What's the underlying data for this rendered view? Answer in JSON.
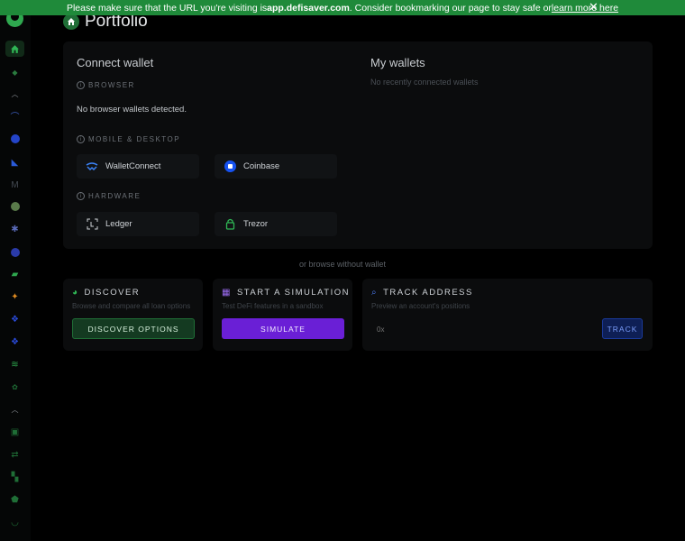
{
  "banner": {
    "text_before": "Please make sure that the URL you're visiting is ",
    "url": "app.defisaver.com",
    "text_after": ". Consider bookmarking our page to stay safe or ",
    "link": "learn more here",
    "close": "✕"
  },
  "page": {
    "title": "Portfolio"
  },
  "connect": {
    "title": "Connect wallet",
    "browser_header": "BROWSER",
    "browser_empty": "No browser wallets detected.",
    "mobile_header": "MOBILE & DESKTOP",
    "hardware_header": "HARDWARE",
    "walletconnect": "WalletConnect",
    "coinbase": "Coinbase",
    "ledger": "Ledger",
    "trezor": "Trezor"
  },
  "my_wallets": {
    "title": "My wallets",
    "empty": "No recently connected wallets"
  },
  "browse_without": "or browse without wallet",
  "discover": {
    "title": "DISCOVER",
    "subtitle": "Browse and compare all loan options",
    "button": "DISCOVER OPTIONS"
  },
  "simulation": {
    "title": "START A SIMULATION",
    "subtitle": "Test DeFi features in a sandbox",
    "button": "SIMULATE"
  },
  "track": {
    "title": "TRACK ADDRESS",
    "subtitle": "Preview an account's positions",
    "placeholder": "0x",
    "button": "TRACK"
  },
  "colors": {
    "banner": "#1f8a3a",
    "simulate": "#6a1fd6",
    "track": "#0e1f55",
    "discover": "#143a21"
  },
  "sidebar_icons": [
    "home-icon",
    "wallet-icon",
    "collapse-icon",
    "protocol-icon",
    "protocol-icon",
    "protocol-icon",
    "protocol-icon",
    "protocol-icon",
    "protocol-icon",
    "protocol-icon",
    "protocol-icon",
    "protocol-icon",
    "protocol-icon",
    "protocol-icon",
    "protocol-icon",
    "protocol-icon",
    "collapse-icon",
    "tool-icon",
    "tool-icon",
    "tool-icon",
    "tool-icon",
    "tool-icon"
  ]
}
